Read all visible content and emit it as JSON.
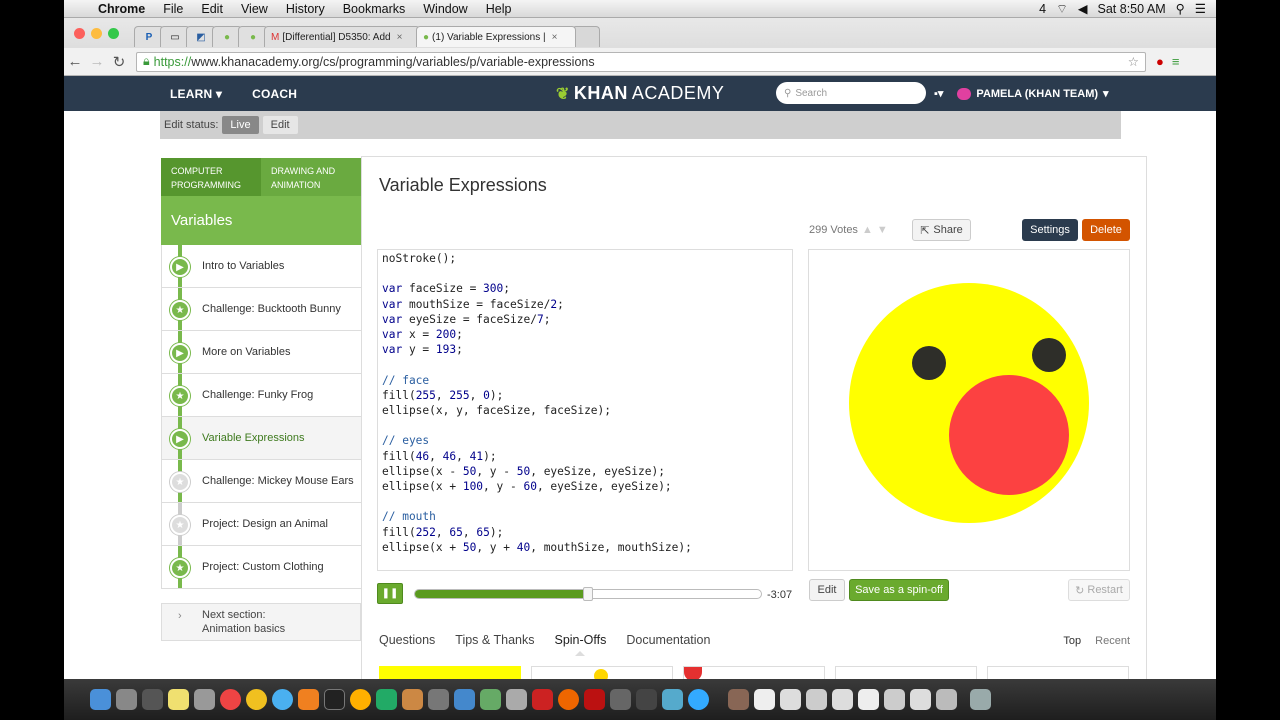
{
  "menubar": {
    "app": "Chrome",
    "items": [
      "File",
      "Edit",
      "View",
      "History",
      "Bookmarks",
      "Window",
      "Help"
    ],
    "status_right": "Sat 8:50 AM",
    "battery_num": "4"
  },
  "browser": {
    "tabs": [
      {
        "label": "P"
      },
      {
        "label": ""
      },
      {
        "label": ""
      },
      {
        "label": ""
      },
      {
        "label": ""
      },
      {
        "label": "[Differential] D5350: Add"
      },
      {
        "label": "(1) Variable Expressions |"
      }
    ],
    "url_scheme": "https://",
    "url_rest": "www.khanacademy.org/cs/programming/variables/p/variable-expressions"
  },
  "khnav": {
    "learn": "LEARN",
    "coach": "COACH",
    "logo_a": "KHAN",
    "logo_b": "ACADEMY",
    "search_placeholder": "Search",
    "user": "PAMELA (KHAN TEAM)"
  },
  "edit_status": {
    "label": "Edit status:",
    "live": "Live",
    "edit": "Edit"
  },
  "sidebar": {
    "crumb1": "COMPUTER PROGRAMMING",
    "crumb2": "DRAWING AND ANIMATION",
    "topic": "Variables",
    "lessons": [
      {
        "label": "Intro to Variables"
      },
      {
        "label": "Challenge: Bucktooth Bunny"
      },
      {
        "label": "More on Variables"
      },
      {
        "label": "Challenge: Funky Frog"
      },
      {
        "label": "Variable Expressions"
      },
      {
        "label": "Challenge: Mickey Mouse Ears"
      },
      {
        "label": "Project: Design an Animal"
      },
      {
        "label": "Project: Custom Clothing"
      }
    ],
    "next_label": "Next section:",
    "next_title": "Animation basics"
  },
  "main": {
    "title": "Variable Expressions",
    "votes": "299 Votes",
    "share": "Share",
    "settings": "Settings",
    "delete": "Delete",
    "time": "-3:07",
    "progress": 0.5,
    "edit": "Edit",
    "spinoff": "Save as a spin-off",
    "restart": "Restart",
    "tabs": [
      "Questions",
      "Tips & Thanks",
      "Spin-Offs",
      "Documentation"
    ],
    "sort": [
      "Top",
      "Recent"
    ]
  },
  "code": {
    "lines": [
      "noStroke();",
      "",
      "var faceSize = 300;",
      "var mouthSize = faceSize/2;",
      "var eyeSize = faceSize/7;",
      "var x = 200;",
      "var y = 193;",
      "",
      "// face",
      "fill(255, 255, 0);",
      "ellipse(x, y, faceSize, faceSize);",
      "",
      "// eyes",
      "fill(46, 46, 41);",
      "ellipse(x - 50, y - 50, eyeSize, eyeSize);",
      "ellipse(x + 100, y - 60, eyeSize, eyeSize);",
      "",
      "// mouth",
      "fill(252, 65, 65);",
      "ellipse(x + 50, y + 40, mouthSize, mouthSize);"
    ]
  },
  "canvas": {
    "face_color": "#ffff00",
    "eye_color": "#2e2e29",
    "mouth_color": "#fc4141"
  }
}
